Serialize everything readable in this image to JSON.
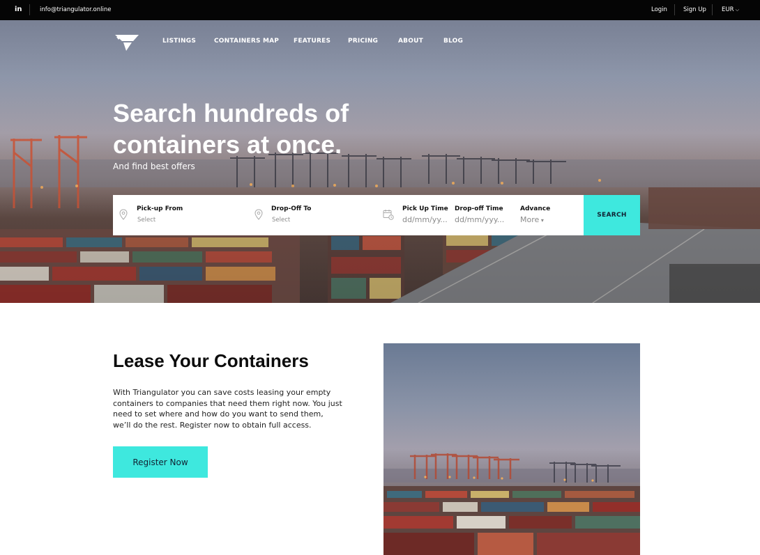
{
  "topbar": {
    "social_icon": "in",
    "email": "info@triangulator.online",
    "login": "Login",
    "signup": "Sign Up",
    "currency": "EUR"
  },
  "nav": {
    "logo_icon": "triangulator-logo-icon",
    "items": [
      "LISTINGS",
      "CONTAINERS MAP",
      "FEATURES",
      "PRICING",
      "ABOUT",
      "BLOG"
    ]
  },
  "hero": {
    "title": "Search hundreds of containers at once.",
    "subtitle": "And find best offers"
  },
  "search": {
    "pickup_label": "Pick-up From",
    "pickup_value": "Select",
    "dropoff_label": "Drop-Off To",
    "dropoff_value": "Select",
    "pickup_time_label": "Pick Up Time",
    "pickup_time_placeholder": "dd/mm/yy...",
    "dropoff_time_label": "Drop-off Time",
    "dropoff_time_placeholder": "dd/mm/yyy...",
    "advance_label": "Advance",
    "advance_value": "More",
    "button": "SEARCH"
  },
  "lease": {
    "title": "Lease Your Containers",
    "text": "With Triangulator you can save costs leasing your empty containers to companies that need them right now. You just need to set where and how do you want to send them, we’ll do the rest. Register now to obtain full access.",
    "button": "Register Now"
  },
  "colors": {
    "accent": "#3ee8de",
    "topbar": "#050505"
  }
}
